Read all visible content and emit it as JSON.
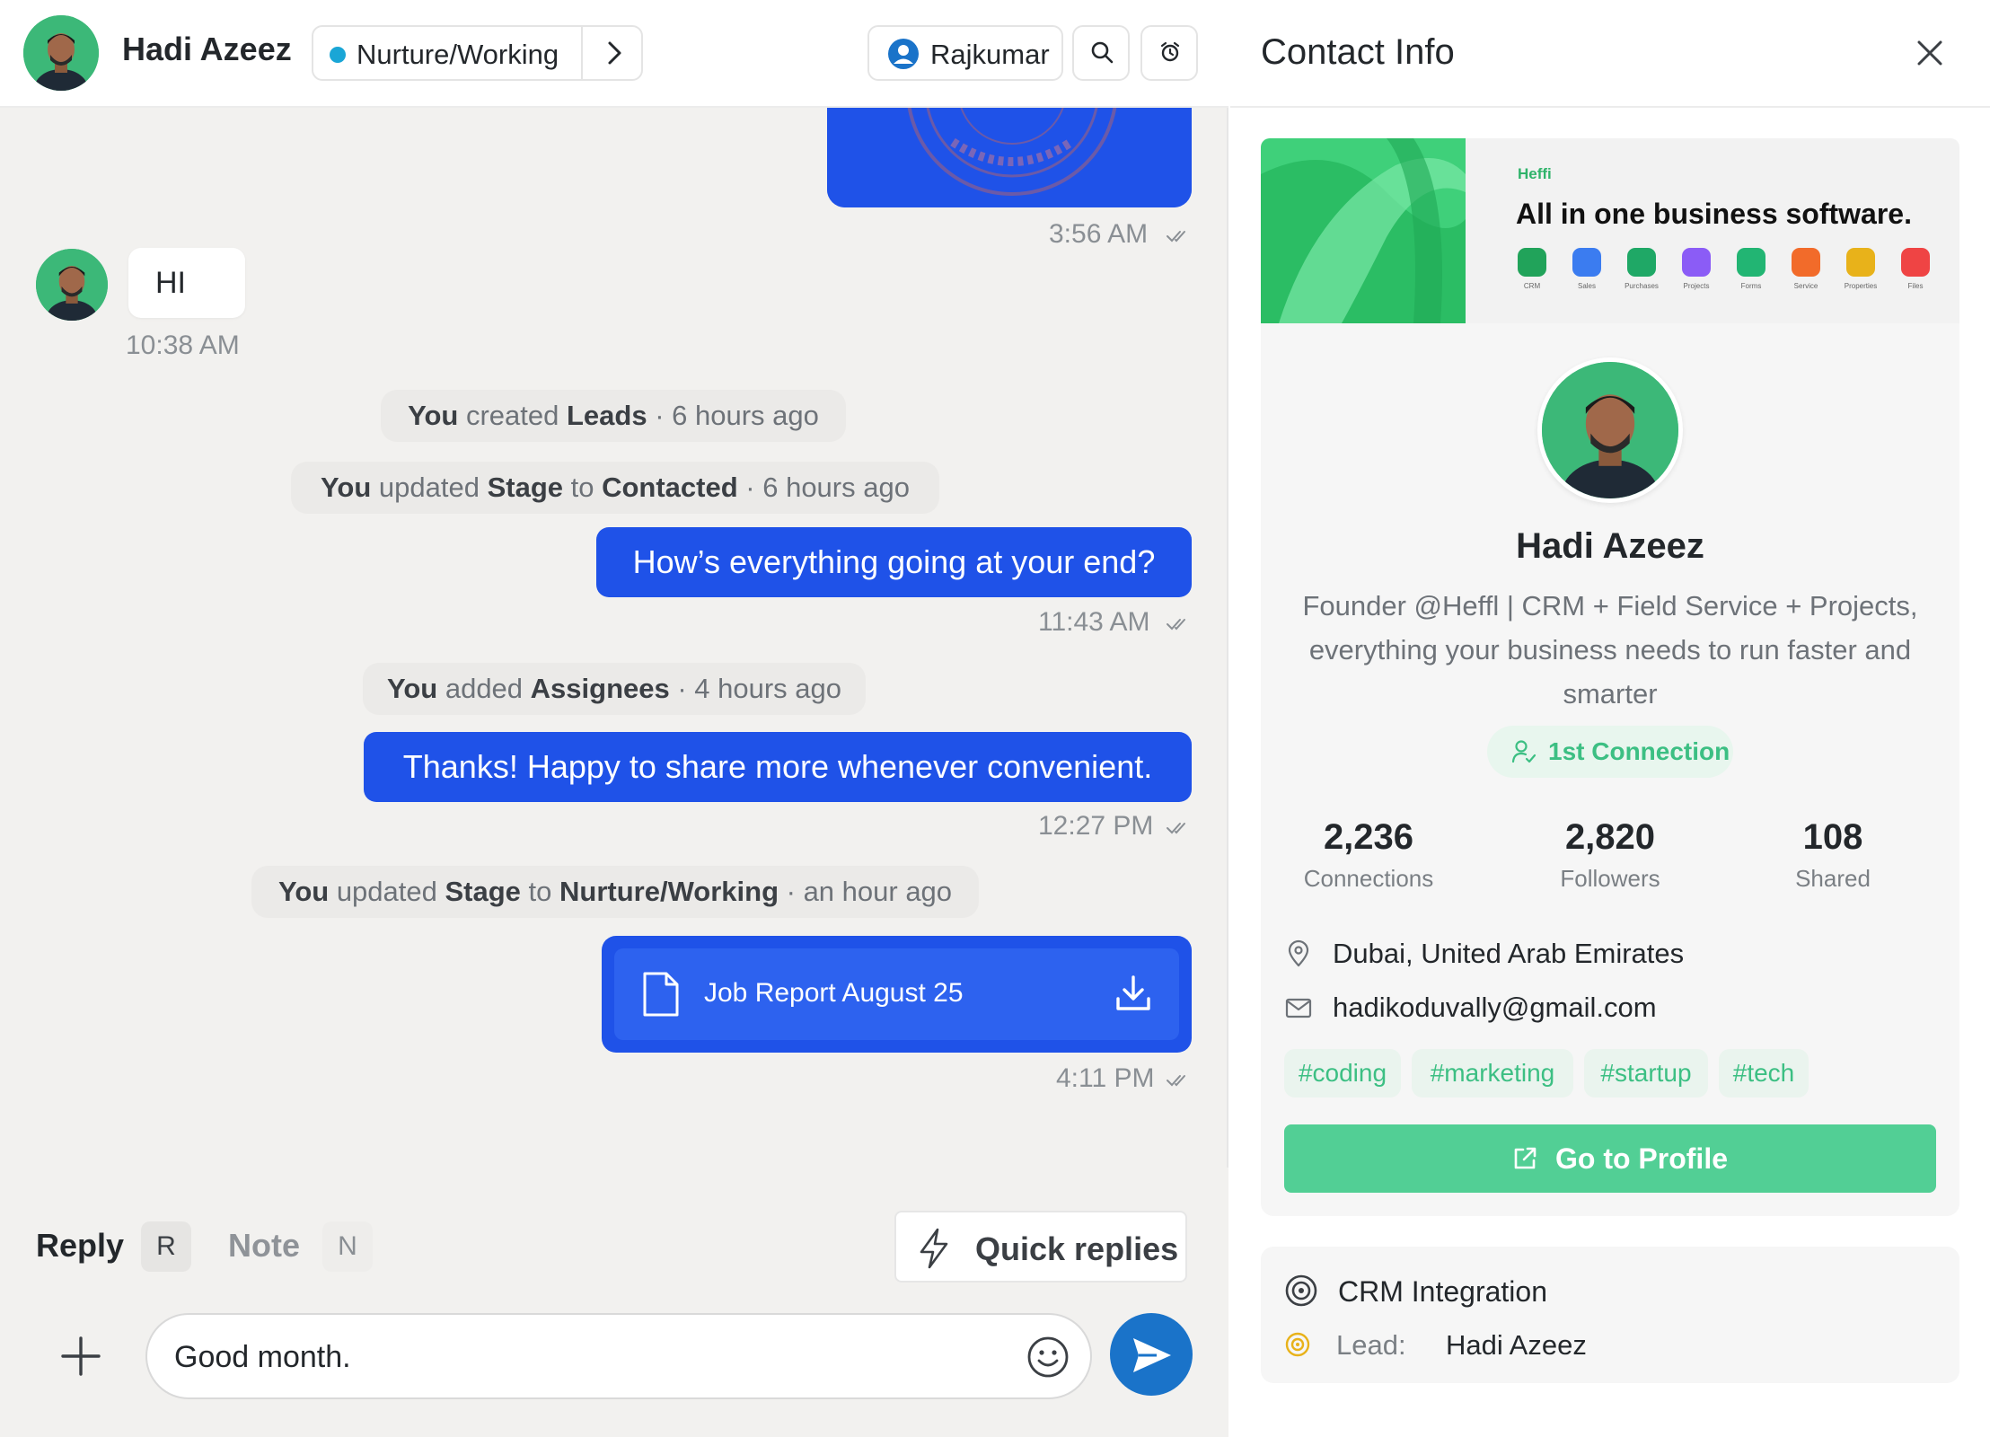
{
  "conversation": {
    "contact_name": "Hadi Azeez",
    "stage": {
      "label": "Nurture/Working",
      "color": "#1aa6d6"
    },
    "assignee": "Rajkumar"
  },
  "messages": {
    "stamp_time": "3:56 AM",
    "incoming_text": "HI",
    "incoming_time": "10:38 AM",
    "activity_1": {
      "actor": "You",
      "verb": " created ",
      "object": "Leads",
      "when": " · 6 hours ago"
    },
    "activity_2": {
      "actor": "You",
      "verb": " updated ",
      "object": "Stage",
      "to": " to ",
      "value": "Contacted",
      "when": " · 6 hours ago"
    },
    "out_1": {
      "text": "How’s everything going at your end?",
      "time": "11:43 AM"
    },
    "activity_3": {
      "actor": "You",
      "verb": " added ",
      "object": "Assignees",
      "when": " · 4 hours ago"
    },
    "out_2": {
      "text": "Thanks! Happy to share more whenever convenient.",
      "time": "12:27 PM"
    },
    "activity_4": {
      "actor": "You",
      "verb": " updated ",
      "object": "Stage",
      "to": " to ",
      "value": "Nurture/Working",
      "when": " · an hour ago"
    },
    "file": {
      "name": "Job Report August 25",
      "time": "4:11 PM"
    }
  },
  "composer": {
    "reply_tab": "Reply",
    "reply_key": "R",
    "note_tab": "Note",
    "note_key": "N",
    "quick_replies": "Quick replies",
    "input_value": "Good month."
  },
  "contact_info": {
    "title": "Contact Info",
    "banner": {
      "brand": "Heffi",
      "headline": "All in one business software.",
      "apps": [
        {
          "label": "CRM",
          "color": "#21a35a"
        },
        {
          "label": "Sales",
          "color": "#3b7cf0"
        },
        {
          "label": "Purchases",
          "color": "#1fa866"
        },
        {
          "label": "Projects",
          "color": "#8b5cf6"
        },
        {
          "label": "Forms",
          "color": "#22b573"
        },
        {
          "label": "Service",
          "color": "#f26b2a"
        },
        {
          "label": "Properties",
          "color": "#e8b21a"
        },
        {
          "label": "Files",
          "color": "#ef4444"
        }
      ]
    },
    "name": "Hadi Azeez",
    "bio": "Founder @Heffl | CRM + Field Service + Projects, everything your business needs to run faster and smarter",
    "connection": "1st Connection",
    "stats": [
      {
        "value": "2,236",
        "label": "Connections"
      },
      {
        "value": "2,820",
        "label": "Followers"
      },
      {
        "value": "108",
        "label": "Shared"
      }
    ],
    "location": "Dubai, United Arab Emirates",
    "email": "hadikoduvally@gmail.com",
    "tags": [
      "#coding",
      "#marketing",
      "#startup",
      "#tech"
    ],
    "profile_button": "Go to Profile",
    "crm": {
      "title": "CRM Integration",
      "lead_key": "Lead:",
      "lead_value": "Hadi Azeez"
    }
  }
}
